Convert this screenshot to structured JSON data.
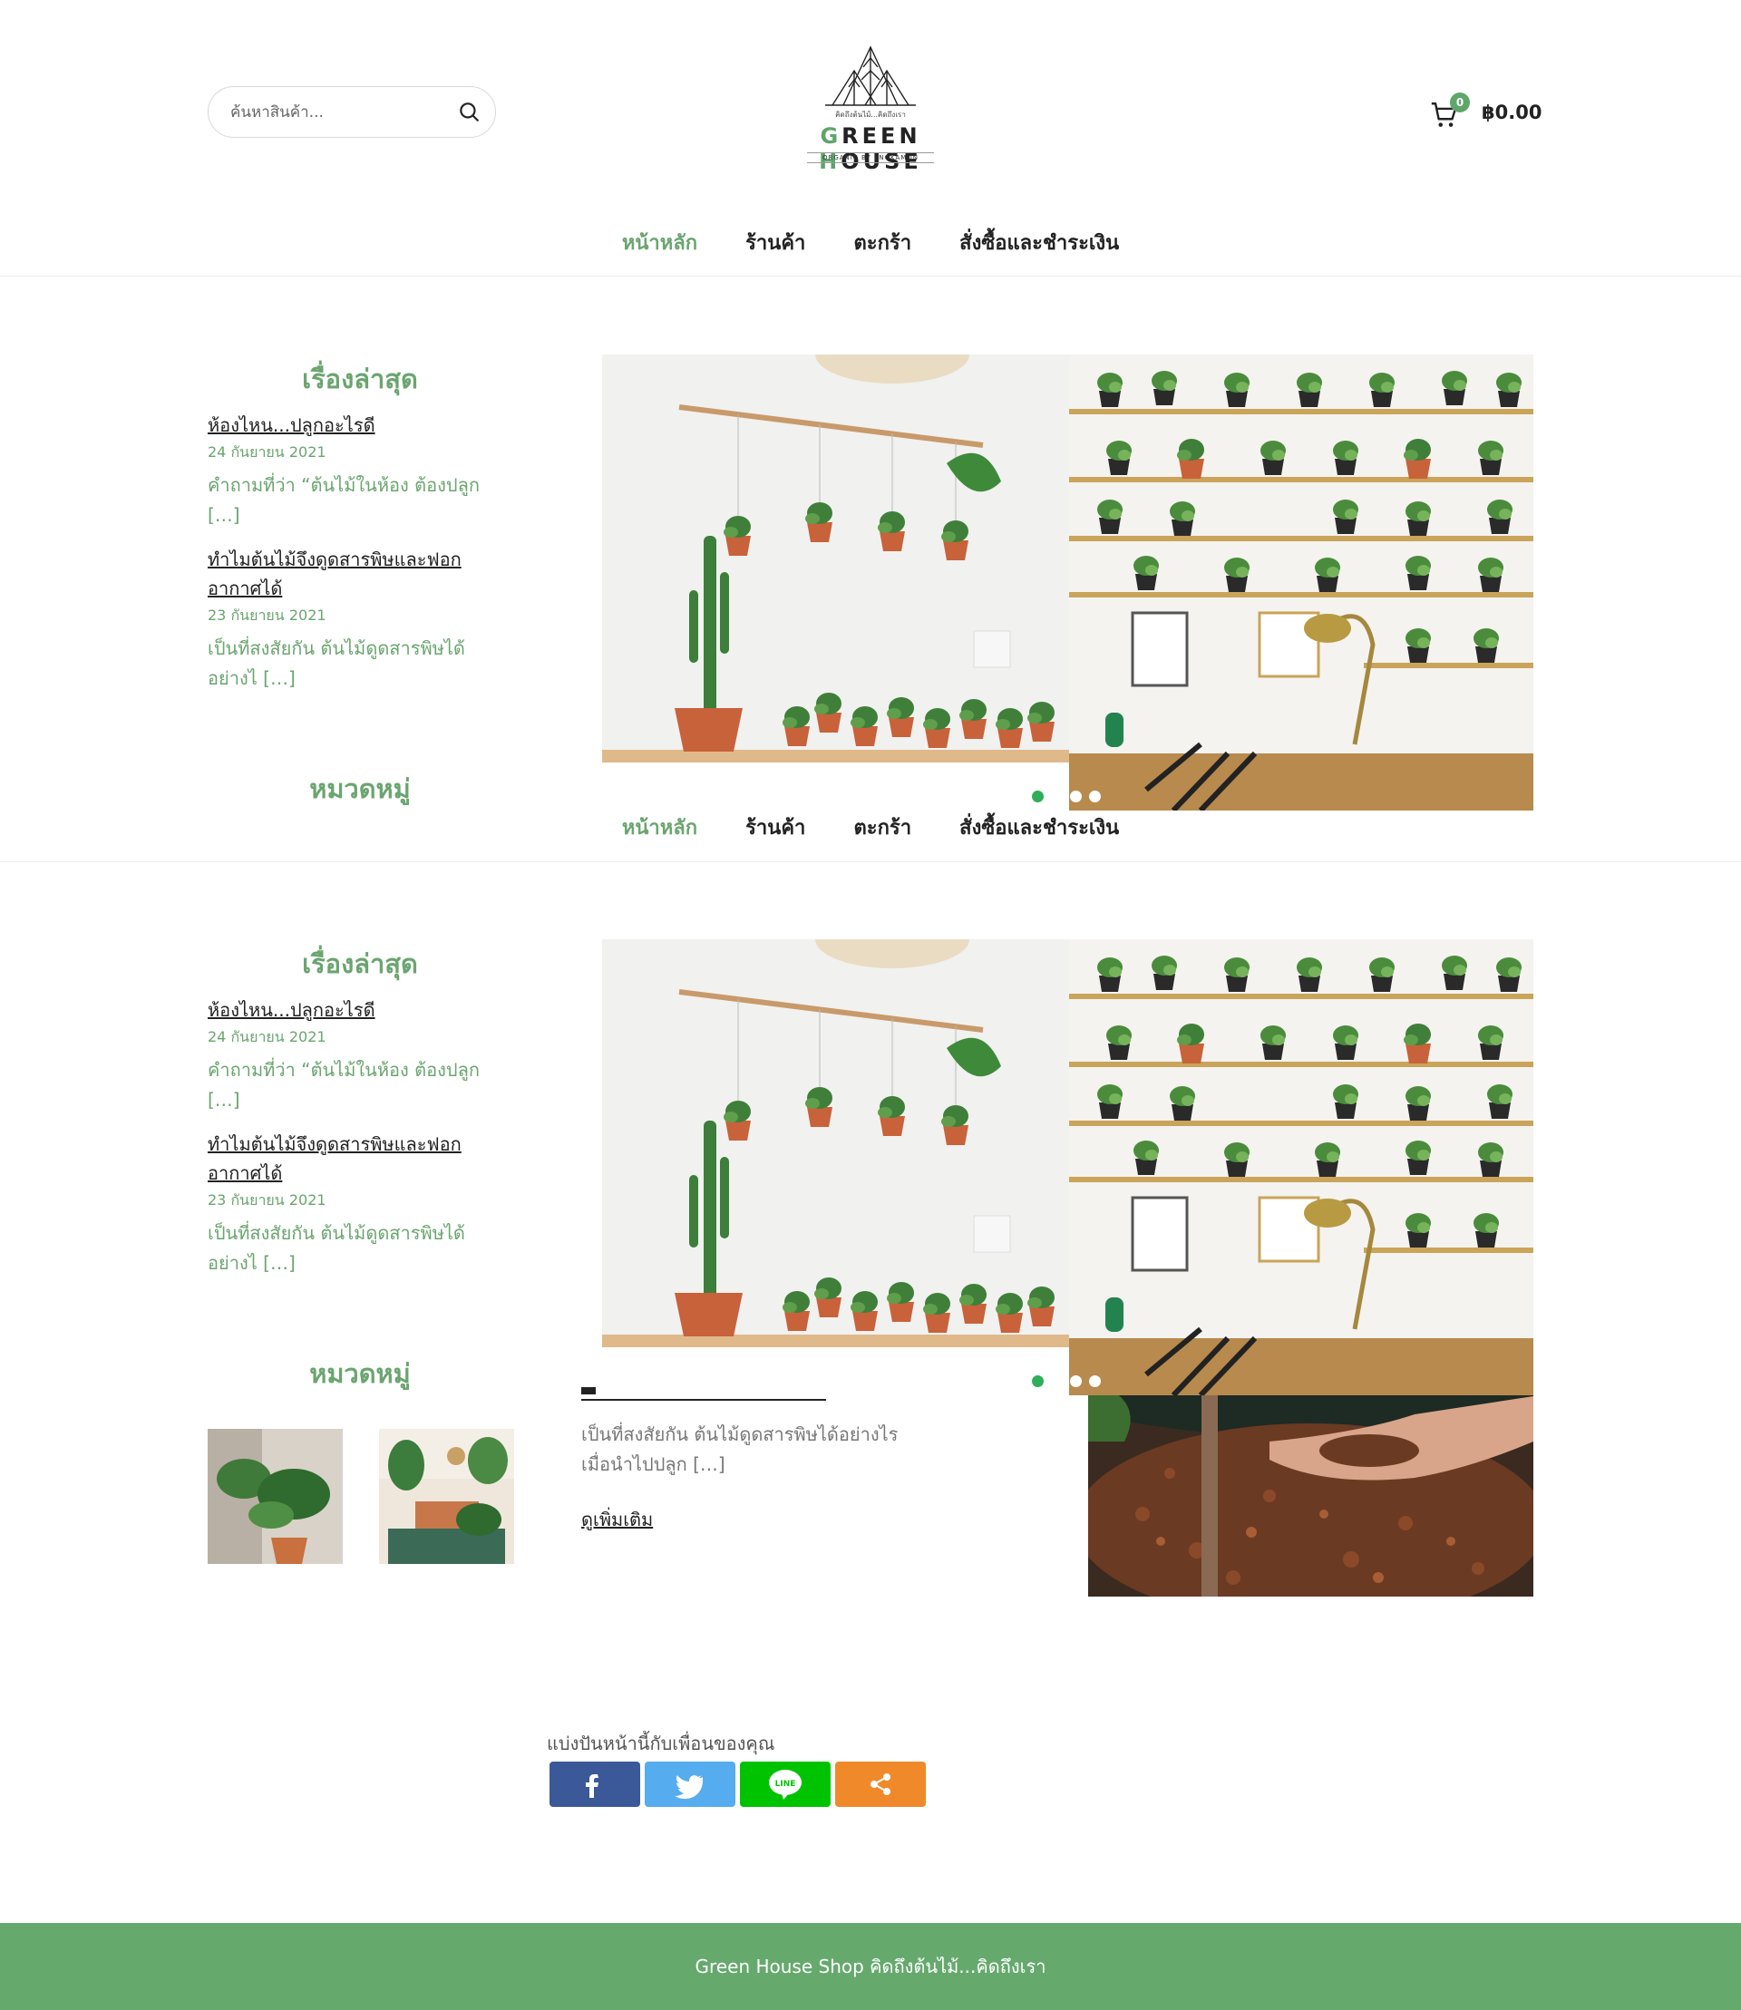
{
  "header": {
    "search": {
      "placeholder": "ค้นหาสินค้า...",
      "value": ""
    },
    "logo": {
      "word_green": "G",
      "word_mid1": "REEN ",
      "word_h": "H",
      "word_mid2": "OUSE",
      "tagline": "คิดถึงต้นไม้...คิดถึงเรา",
      "subtitle": "ORGANIC BY ENGKAMON"
    },
    "cart": {
      "count": "0",
      "total": "฿0.00"
    }
  },
  "nav": {
    "items": [
      {
        "label": "หน้าหลัก",
        "active": true
      },
      {
        "label": "ร้านค้า"
      },
      {
        "label": "ตะกร้า"
      },
      {
        "label": "สั่งซื้อและชำระเงิน"
      }
    ]
  },
  "sidebar": {
    "latest_title": "เรื่องล่าสุด",
    "posts": [
      {
        "title": "ห้องไหน...ปลูกอะไรดี",
        "date": "24 กันยายน 2021",
        "excerpt_line1": "คำถามที่ว่า “ต้นไม้ในห้อง ต้องปลูก",
        "excerpt_line2": "[…]"
      },
      {
        "title_line1": "ทำไมต้นไม้จึงดูดสารพิษและฟอก",
        "title_line2": "อากาศได้",
        "date": "23 กันยายน 2021",
        "excerpt_line1": "เป็นที่สงสัยกัน ต้นไม้ดูดสารพิษได้",
        "excerpt_line2": "อย่างไ […]"
      }
    ],
    "categories_title": "หมวดหมู่"
  },
  "slider": {
    "slides": 4,
    "active": 0
  },
  "article": {
    "excerpt_line1": "เป็นที่สงสัยกัน ต้นไม้ดูดสารพิษได้อย่างไร",
    "excerpt_line2": "เมื่อนำไปปลูก […]",
    "read_more": "ดูเพิ่มเติม"
  },
  "share": {
    "label": "แบ่งปันหน้านี้กับเพื่อนของคุณ",
    "buttons": [
      "facebook",
      "twitter",
      "line",
      "share"
    ],
    "line_text": "LINE"
  },
  "footer": {
    "text": "Green House Shop คิดถึงต้นไม้...คิดถึงเรา"
  },
  "colors": {
    "accent": "#6aa56f",
    "footer": "#66a96d",
    "facebook": "#3b5998",
    "twitter": "#55acee",
    "line": "#00c300",
    "share": "#f0892a"
  }
}
